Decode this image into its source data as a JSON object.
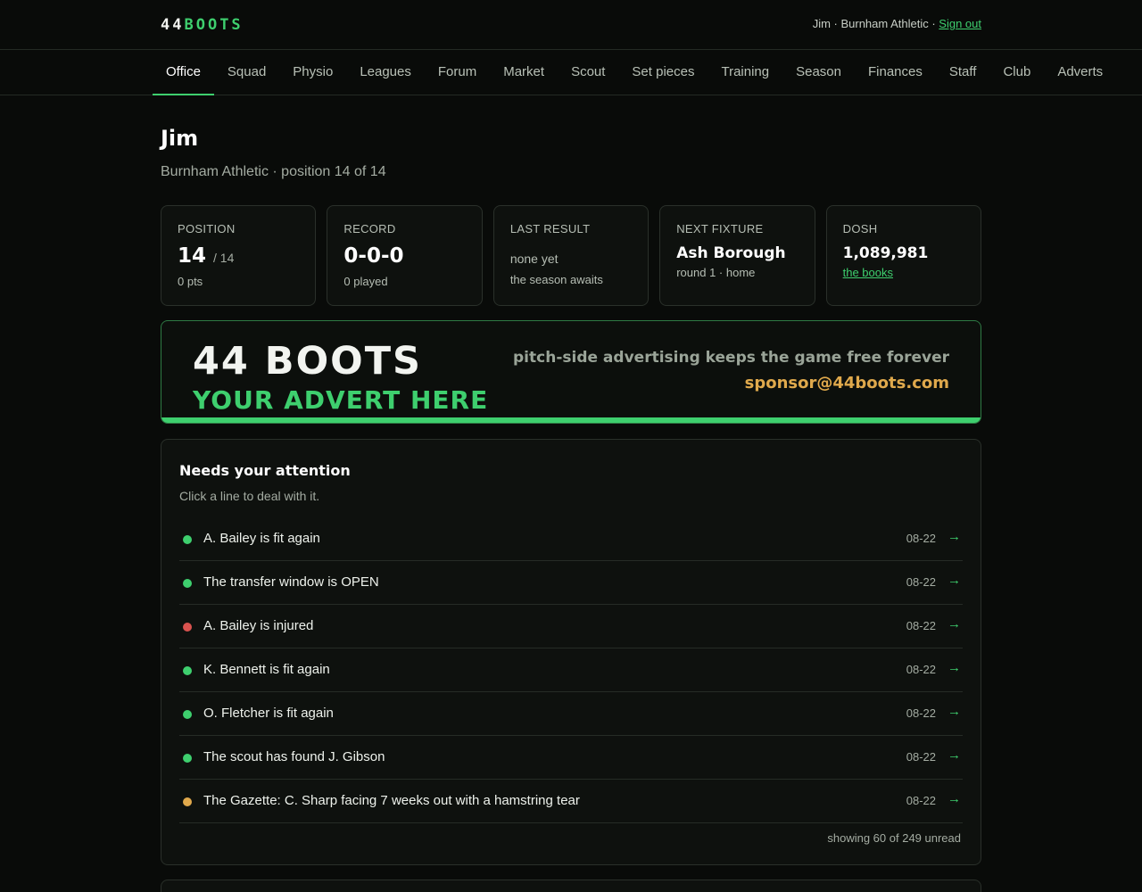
{
  "header": {
    "logo_part1": "44",
    "logo_part2": "BOOTS",
    "user_text": "Jim · Burnham Athletic · ",
    "signout_label": "Sign out"
  },
  "nav": {
    "items": [
      {
        "label": "Office",
        "active": true
      },
      {
        "label": "Squad"
      },
      {
        "label": "Physio"
      },
      {
        "label": "Leagues"
      },
      {
        "label": "Forum"
      },
      {
        "label": "Market"
      },
      {
        "label": "Scout"
      },
      {
        "label": "Set pieces"
      },
      {
        "label": "Training"
      },
      {
        "label": "Season"
      },
      {
        "label": "Finances"
      },
      {
        "label": "Staff"
      },
      {
        "label": "Club"
      },
      {
        "label": "Adverts"
      }
    ]
  },
  "page": {
    "title": "Jim",
    "subtitle": "Burnham Athletic · position 14 of 14"
  },
  "stats": {
    "position": {
      "label": "POSITION",
      "value": "14",
      "of": "/ 14",
      "sub": "0 pts"
    },
    "record": {
      "label": "RECORD",
      "value": "0-0-0",
      "sub": "0 played"
    },
    "last_result": {
      "label": "LAST RESULT",
      "value": "none yet",
      "sub": "the season awaits"
    },
    "next_fixture": {
      "label": "NEXT FIXTURE",
      "value": "Ash Borough",
      "sub": "round 1 · home"
    },
    "dosh": {
      "label": "DOSH",
      "value": "1,089,981",
      "link": "the books"
    }
  },
  "advert": {
    "brand": "44 BOOTS",
    "cta": "YOUR ADVERT HERE",
    "tagline": "pitch-side advertising keeps the game free forever",
    "email": "sponsor@44boots.com"
  },
  "attention": {
    "title": "Needs your attention",
    "subtitle": "Click a line to deal with it.",
    "items": [
      {
        "text": "A. Bailey is fit again",
        "date": "08-22",
        "status": "green"
      },
      {
        "text": "The transfer window is OPEN",
        "date": "08-22",
        "status": "green"
      },
      {
        "text": "A. Bailey is injured",
        "date": "08-22",
        "status": "red"
      },
      {
        "text": "K. Bennett is fit again",
        "date": "08-22",
        "status": "green"
      },
      {
        "text": "O. Fletcher is fit again",
        "date": "08-22",
        "status": "green"
      },
      {
        "text": "The scout has found J. Gibson",
        "date": "08-22",
        "status": "green"
      },
      {
        "text": "The Gazette: C. Sharp facing 7 weeks out with a hamstring tear",
        "date": "08-22",
        "status": "amber"
      }
    ],
    "arrow": "→",
    "footer": "showing 60 of 249 unread"
  },
  "colors": {
    "accent": "#3ecf6e",
    "danger": "#d9534f",
    "warning": "#e0a94c",
    "background": "#090b09"
  }
}
